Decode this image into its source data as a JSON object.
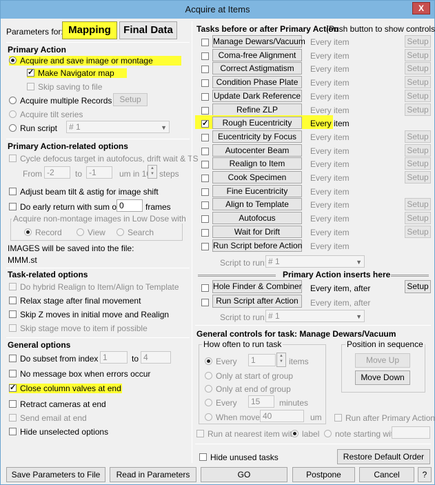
{
  "window": {
    "title": "Acquire at Items",
    "close_glyph": "X"
  },
  "params_for": {
    "label": "Parameters for:",
    "mapping": "Mapping",
    "final": "Final Data"
  },
  "primary": {
    "title": "Primary Action",
    "acquire_save": "Acquire and save image or montage",
    "make_nav_map": "Make Navigator map",
    "skip_saving": "Skip saving to file",
    "acquire_multiple": "Acquire multiple Records",
    "setup": "Setup",
    "acquire_tilt": "Acquire tilt series",
    "run_script": "Run script",
    "script_value": "# 1"
  },
  "related": {
    "title": "Primary Action-related options",
    "cycle_defocus": "Cycle defocus target in autofocus, drift wait & TS",
    "from": "From",
    "from_val": "-2",
    "to": "to",
    "to_val": "-1",
    "um_in": "um in 10",
    "steps": "steps",
    "adjust_beam": "Adjust beam tilt & astig for image shift",
    "early_return": "Do early return with sum of",
    "early_val": "0",
    "frames": "frames",
    "acq_nonmontage": "Acquire non-montage images in Low Dose with",
    "record": "Record",
    "view": "View",
    "search": "Search",
    "saved_into": "IMAGES will be saved into the file:",
    "filename": "MMM.st"
  },
  "taskopts": {
    "title": "Task-related options",
    "hybrid": "Do hybrid Realign to Item/Align to Template",
    "relax": "Relax stage after final movement",
    "skipz": "Skip Z moves in initial move and Realign",
    "skipstage": "Skip stage move to item if possible"
  },
  "general": {
    "title": "General options",
    "subset": "Do subset from index",
    "subset_from": "1",
    "subset_to_lbl": "to",
    "subset_to": "4",
    "no_msgbox": "No message box when errors occur",
    "close_valves": "Close column valves at end",
    "retract": "Retract cameras at end",
    "send_email": "Send email at end",
    "hide_unselected": "Hide unselected options"
  },
  "tasks": {
    "title": "Tasks before or after Primary Action",
    "hint": "(Push button to show controls)",
    "items": [
      {
        "label": "Manage Dewars/Vacuum",
        "every": "Every item",
        "setup": "Setup"
      },
      {
        "label": "Coma-free Alignment",
        "every": "Every item",
        "setup": "Setup"
      },
      {
        "label": "Correct Astigmatism",
        "every": "Every item",
        "setup": "Setup"
      },
      {
        "label": "Condition Phase Plate",
        "every": "Every item",
        "setup": "Setup"
      },
      {
        "label": "Update Dark Reference",
        "every": "Every item",
        "setup": "Setup"
      },
      {
        "label": "Refine ZLP",
        "every": "Every item",
        "setup": "Setup"
      },
      {
        "label": "Rough Eucentricity",
        "every": "Every item",
        "setup": ""
      },
      {
        "label": "Eucentricity by Focus",
        "every": "Every item",
        "setup": "Setup"
      },
      {
        "label": "Autocenter Beam",
        "every": "Every item",
        "setup": "Setup"
      },
      {
        "label": "Realign to Item",
        "every": "Every item",
        "setup": "Setup"
      },
      {
        "label": "Cook Specimen",
        "every": "Every item",
        "setup": "Setup"
      },
      {
        "label": "Fine Eucentricity",
        "every": "Every item",
        "setup": ""
      },
      {
        "label": "Align to Template",
        "every": "Every item",
        "setup": "Setup"
      },
      {
        "label": "Autofocus",
        "every": "Every item",
        "setup": "Setup"
      },
      {
        "label": "Wait for Drift",
        "every": "Every item",
        "setup": "Setup"
      },
      {
        "label": "Run Script before Action",
        "every": "Every item",
        "setup": ""
      }
    ],
    "script_to_run": "Script to run:",
    "script_val": "# 1",
    "inserts_here": "Primary Action inserts here",
    "hole_finder": "Hole Finder & Combiner",
    "hole_every": "Every item, after",
    "hole_setup": "Setup",
    "run_after": "Run Script after Action",
    "run_after_every": "Every item, after",
    "script_to_run2": "Script to run:",
    "script_val2": "# 1"
  },
  "gen_controls": {
    "title": "General controls for task: Manage Dewars/Vacuum",
    "how_often": "How often to run task",
    "every": "Every",
    "every_val": "1",
    "items": "items",
    "only_start": "Only at start of group",
    "only_end": "Only at end of group",
    "every2": "Every",
    "every2_val": "15",
    "minutes": "minutes",
    "when_moved": "When moved >",
    "moved_val": "40",
    "um": "um",
    "position": "Position in sequence",
    "move_up": "Move Up",
    "move_down": "Move Down",
    "run_after_primary": "Run after Primary Action",
    "run_nearest": "Run at nearest item with",
    "label": "label",
    "note_starting": "note starting with"
  },
  "bottom": {
    "hide_unused": "Hide unused tasks",
    "restore_default": "Restore Default Order",
    "save_params": "Save Parameters to File",
    "read_params": "Read in Parameters",
    "go": "GO",
    "postpone": "Postpone",
    "cancel": "Cancel",
    "help": "?"
  },
  "colors": {
    "highlight": "#ffff33",
    "titlebar": "#7fb6e0",
    "close": "#c75050"
  }
}
